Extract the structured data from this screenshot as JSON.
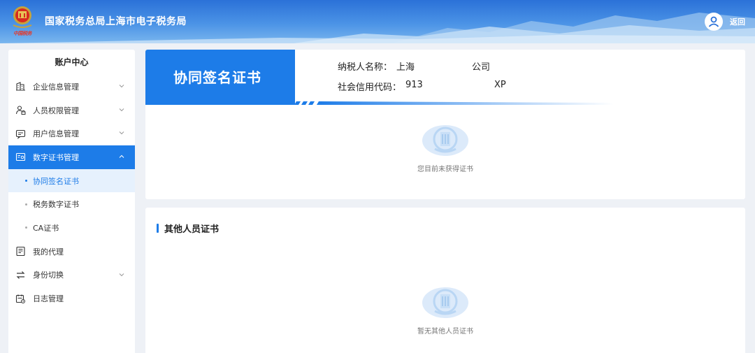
{
  "header": {
    "emblem_motto": "中国税务",
    "site_title": "国家税务总局上海市电子税务局",
    "back_label": "返回"
  },
  "sidebar": {
    "title": "账户中心",
    "items": [
      {
        "label": "企业信息管理",
        "icon": "building-icon",
        "expandable": true
      },
      {
        "label": "人员权限管理",
        "icon": "user-lock-icon",
        "expandable": true
      },
      {
        "label": "用户信息管理",
        "icon": "message-card-icon",
        "expandable": true
      },
      {
        "label": "数字证书管理",
        "icon": "certificate-icon",
        "expandable": true,
        "active": true
      }
    ],
    "sub_items": [
      {
        "label": "协同签名证书",
        "active": true
      },
      {
        "label": "税务数字证书",
        "active": false
      },
      {
        "label": "CA证书",
        "active": false
      }
    ],
    "items_after": [
      {
        "label": "我的代理",
        "icon": "document-list-icon",
        "expandable": false
      },
      {
        "label": "身份切换",
        "icon": "switch-arrows-icon",
        "expandable": true
      },
      {
        "label": "日志管理",
        "icon": "calendar-log-icon",
        "expandable": false
      }
    ]
  },
  "cert_panel": {
    "banner_title": "协同签名证书",
    "taxpayer_name_label": "纳税人名称：",
    "taxpayer_name_prefix": "上海",
    "taxpayer_name_suffix": "公司",
    "credit_code_label": "社会信用代码：",
    "credit_code_prefix": "913",
    "credit_code_suffix": "XP",
    "empty_text": "您目前未获得证书"
  },
  "others_panel": {
    "title": "其他人员证书",
    "empty_text": "暂无其他人员证书"
  },
  "colors": {
    "accent": "#1d7ce8",
    "header_top": "#2b71d8",
    "header_bottom": "#7ab6ee",
    "active_sub_bg": "#e6f1fd"
  }
}
